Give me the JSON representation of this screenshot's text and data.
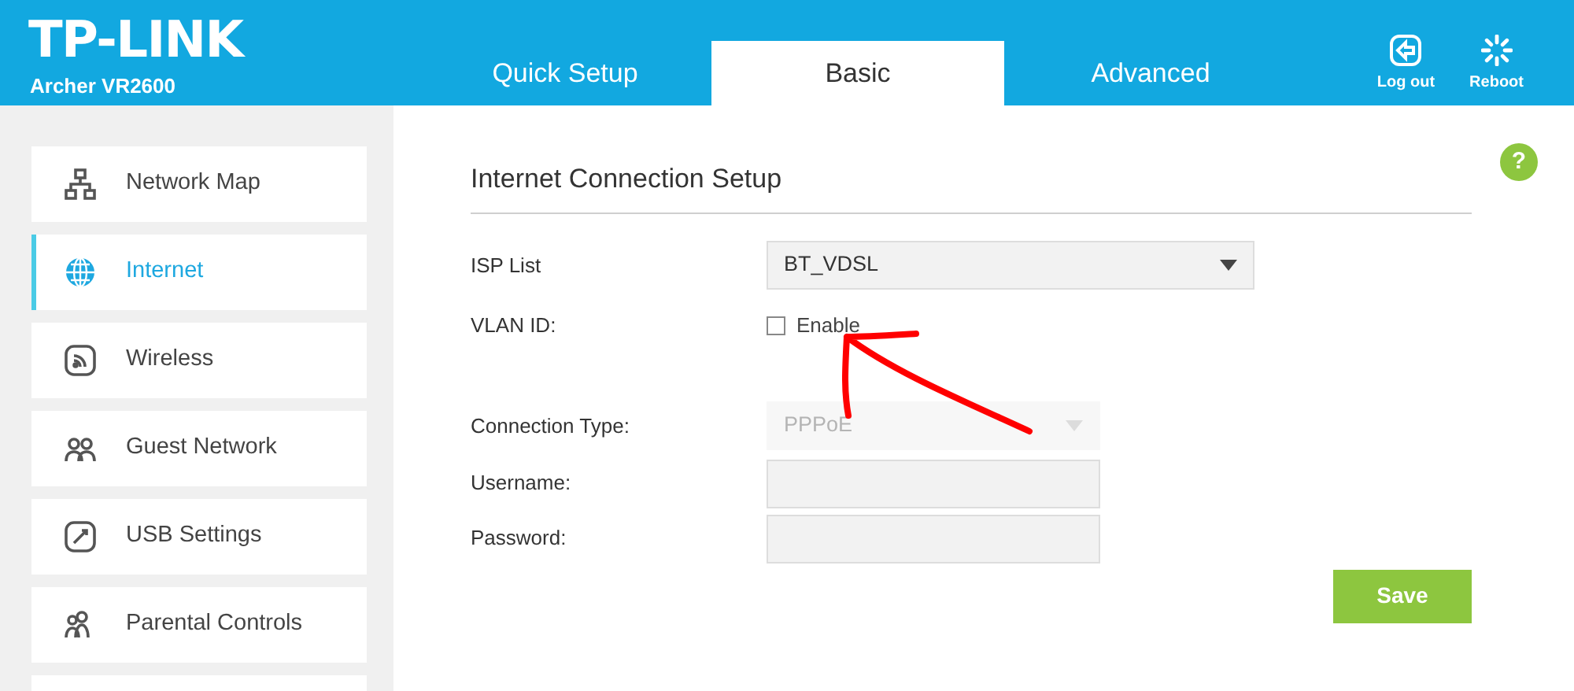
{
  "brand": {
    "logo": "TP-LINK",
    "model": "Archer VR2600"
  },
  "tabs": [
    {
      "label": "Quick Setup",
      "selected": false
    },
    {
      "label": "Basic",
      "selected": true
    },
    {
      "label": "Advanced",
      "selected": false
    }
  ],
  "header_actions": [
    {
      "kind": "logout",
      "label": "Log out"
    },
    {
      "kind": "reboot",
      "label": "Reboot"
    }
  ],
  "sidebar": {
    "items": [
      {
        "kind": "network-map",
        "label": "Network Map",
        "selected": false
      },
      {
        "kind": "internet",
        "label": "Internet",
        "selected": true
      },
      {
        "kind": "wireless",
        "label": "Wireless",
        "selected": false
      },
      {
        "kind": "guest",
        "label": "Guest Network",
        "selected": false
      },
      {
        "kind": "usb",
        "label": "USB Settings",
        "selected": false
      },
      {
        "kind": "parental",
        "label": "Parental Controls",
        "selected": false
      },
      {
        "kind": "blank",
        "selected": false
      }
    ]
  },
  "section": {
    "title": "Internet Connection Setup",
    "help": "?"
  },
  "form": [
    {
      "kind": "select",
      "label": "ISP List",
      "value": "BT_VDSL",
      "disabled": false,
      "wide": true
    },
    {
      "kind": "checkbox",
      "label": "VLAN ID:",
      "option": "Enable",
      "checked": false
    },
    {
      "kind": "select",
      "label": "Connection Type:",
      "value": "PPPoE",
      "disabled": true,
      "wide": false
    },
    {
      "kind": "input",
      "label": "Username:"
    },
    {
      "kind": "input",
      "label": "Password:"
    }
  ],
  "save_button": "Save"
}
